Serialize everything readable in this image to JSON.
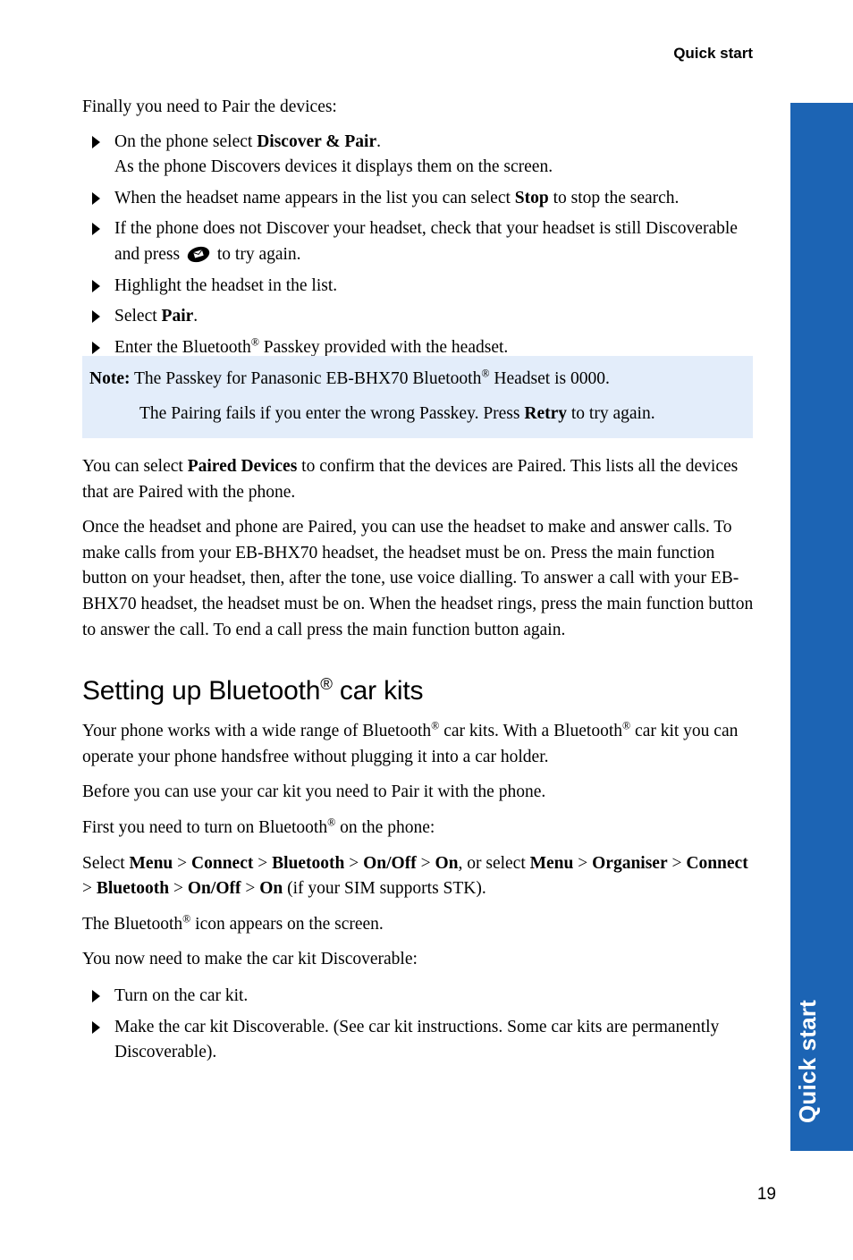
{
  "page": {
    "running_header": "Quick start",
    "page_number": "19",
    "side_tab_label": "Quick start",
    "accent_color": "#1C64B4",
    "note_background_color": "#E3EDFA"
  },
  "intro": {
    "lead": "Finally you need to Pair the devices:"
  },
  "pair_steps": [
    {
      "prefix": "On the phone select ",
      "bold": "Discover & Pair",
      "suffix": ".",
      "subline": "As the phone Discovers devices it displays them on the screen."
    },
    {
      "prefix": "When the headset name appears in the list you can select ",
      "bold": "Stop",
      "suffix": " to stop the search.",
      "subline": ""
    },
    {
      "prefix": "If the phone does not Discover your headset, check that your headset is still Discoverable and press ",
      "icon": "envelope-softkey-icon",
      "suffix": " to try again.",
      "subline": ""
    },
    {
      "prefix": "Highlight the headset in the list.",
      "bold": "",
      "suffix": "",
      "subline": ""
    },
    {
      "prefix": "Select ",
      "bold": "Pair",
      "suffix": ".",
      "subline": ""
    },
    {
      "prefix": "Enter the Bluetooth",
      "reg": "®",
      "suffix": " Passkey provided with the headset.",
      "subline": ""
    }
  ],
  "note": {
    "label": "Note:",
    "line1_a": " The Passkey for Panasonic EB-BHX70 Bluetooth",
    "line1_reg": "®",
    "line1_b": " Headset is 0000.",
    "line2_a": "The Pairing fails if you enter the wrong Passkey. Press ",
    "line2_bold": "Retry",
    "line2_b": " to try again."
  },
  "paragraphs": {
    "paired_devices_a": "You can select ",
    "paired_devices_bold": "Paired Devices",
    "paired_devices_b": " to confirm that the devices are Paired. This lists all the devices that are Paired with the phone.",
    "usage": "Once the headset and phone are Paired, you can use the headset to make and answer calls. To make calls from your EB-BHX70 headset, the headset must be on. Press the main function button on your headset, then, after the tone, use voice dialling. To answer a call with your EB-BHX70 headset, the headset must be on. When the headset rings, press the main function button to answer the call. To end a call press the main function button again."
  },
  "section": {
    "heading_a": "Setting up Bluetooth",
    "heading_reg": "®",
    "heading_b": " car kits",
    "p1_a": "Your phone works with a wide range of Bluetooth",
    "p1_reg1": "®",
    "p1_b": " car kits. With a Bluetooth",
    "p1_reg2": "®",
    "p1_c": " car kit you can operate your phone handsfree without plugging it into a car holder.",
    "p2": "Before you can use your car kit you need to Pair it with the phone.",
    "p3_a": "First you need to turn on Bluetooth",
    "p3_reg": "®",
    "p3_b": " on the phone:",
    "menu_path": {
      "t0": "Select ",
      "b1": "Menu",
      "s1": " > ",
      "b2": "Connect",
      "s2": " > ",
      "b3": "Bluetooth",
      "s3": " > ",
      "b4": "On/Off",
      "s4": " > ",
      "b5": "On",
      "t1": ", or select ",
      "b6": "Menu",
      "s5": " > ",
      "b7": "Organiser",
      "s6": " > ",
      "b8": "Connect",
      "s7": " > ",
      "b9": "Bluetooth",
      "s8": " > ",
      "b10": "On/Off",
      "s9": " > ",
      "b11": "On",
      "t2": " (if your SIM supports STK)."
    },
    "p4_a": "The Bluetooth",
    "p4_reg": "®",
    "p4_b": " icon appears on the screen.",
    "p5": "You now need to make the car kit Discoverable:"
  },
  "carkit_steps": [
    {
      "text": "Turn on the car kit."
    },
    {
      "text": "Make the car kit Discoverable. (See car kit instructions. Some car kits are permanently Discoverable)."
    }
  ]
}
